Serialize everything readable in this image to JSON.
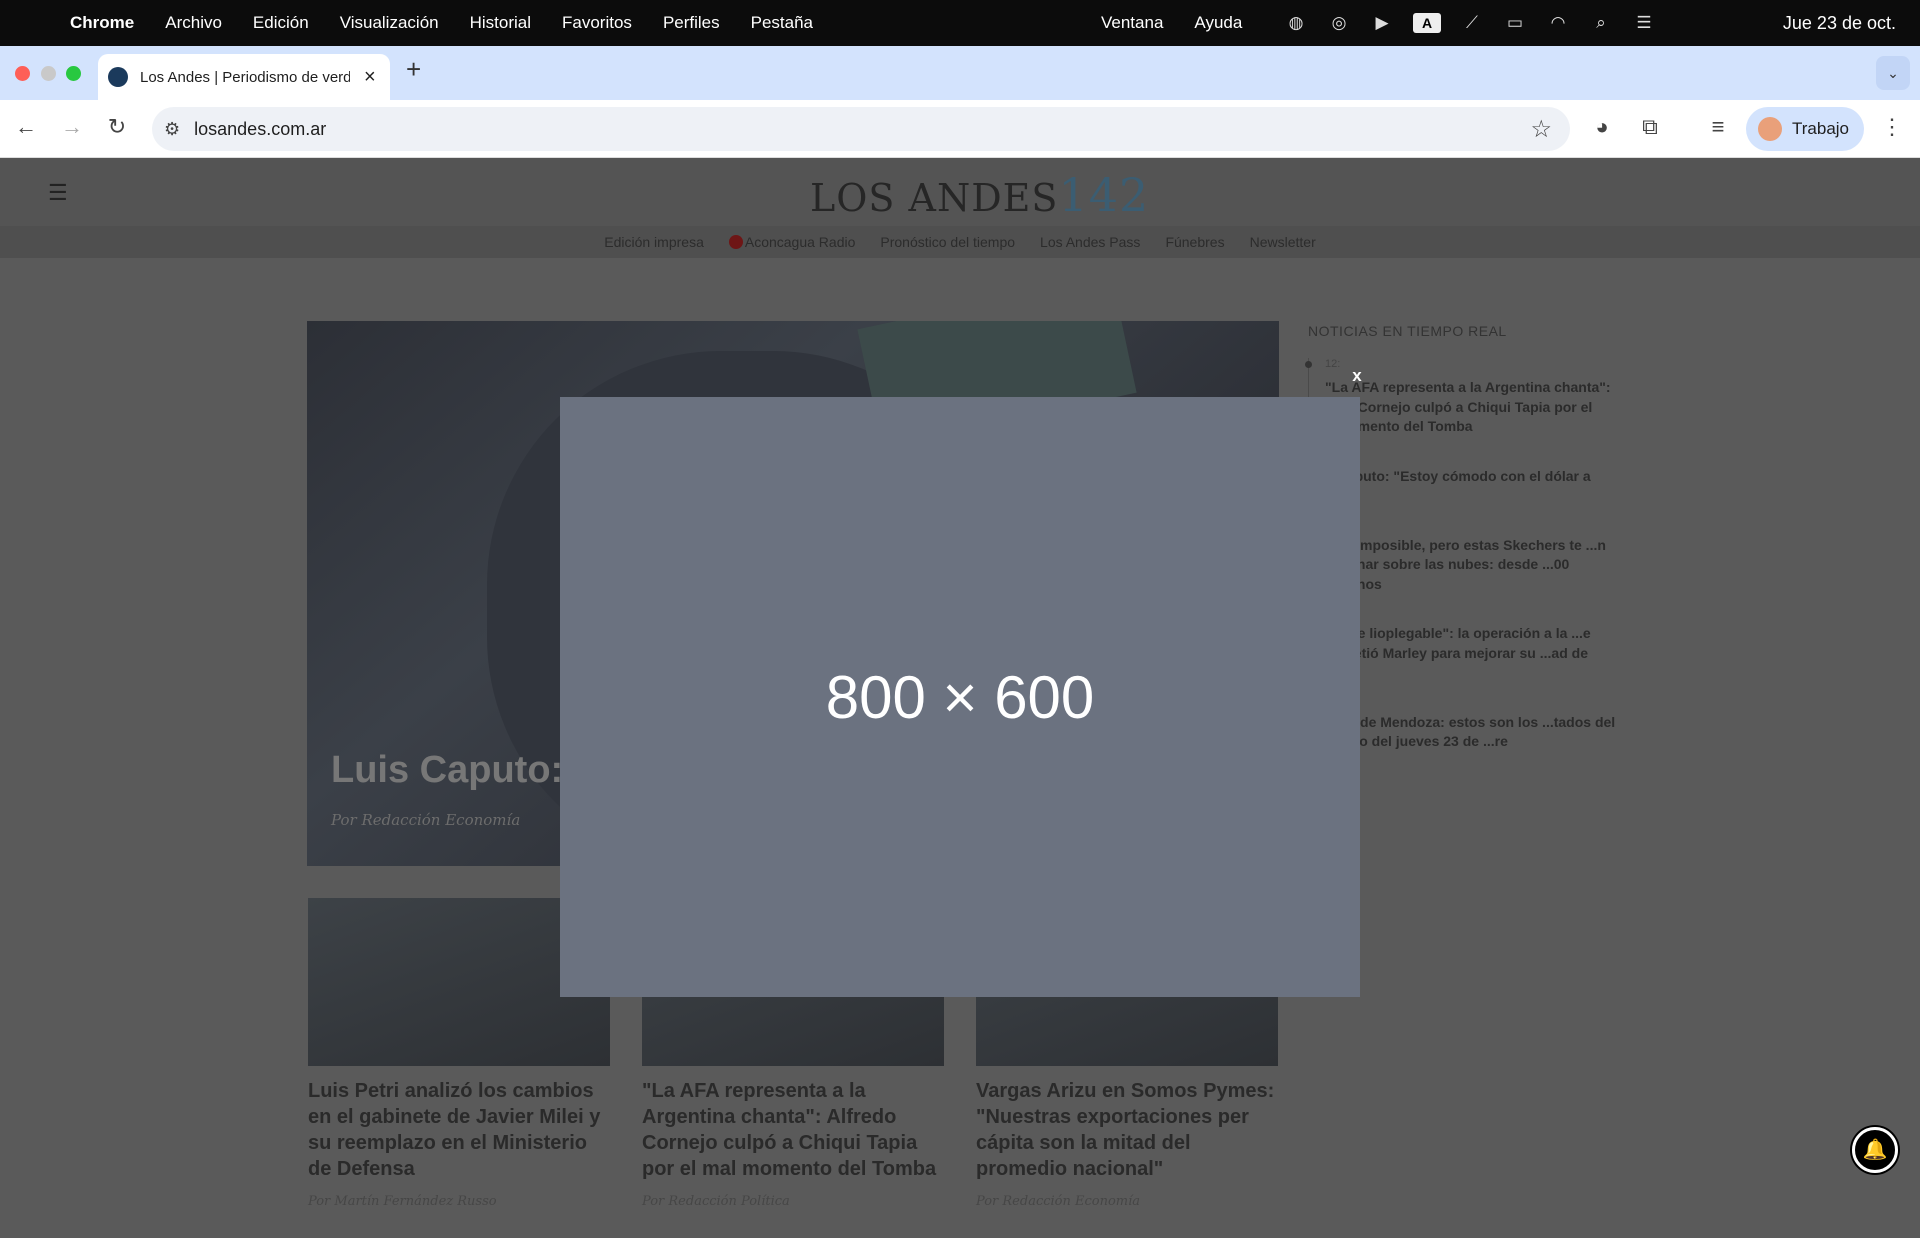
{
  "menubar": {
    "app_name": "Chrome",
    "menus": [
      "Archivo",
      "Edición",
      "Visualización",
      "Historial",
      "Favoritos",
      "Perfiles",
      "Pestaña"
    ],
    "right_menus": [
      "Ventana",
      "Ayuda"
    ],
    "keyboard_indicator": "A",
    "clock": "Jue 23 de oct."
  },
  "browser": {
    "tab_title": "Los Andes | Periodismo de verdad",
    "address": "losandes.com.ar",
    "profile_label": "Trabajo"
  },
  "site": {
    "logo_text": "LOS ANDES",
    "logo_number": "142",
    "subnav": [
      "Edición impresa",
      "Aconcagua Radio",
      "Pronóstico del tiempo",
      "Los Andes Pass",
      "Fúnebres",
      "Newsletter"
    ],
    "hero": {
      "title": "Luis Caputo: \"",
      "byline": "Por Redacción Economía"
    },
    "cards": [
      {
        "title": "Luis Petri analizó los cambios en el gabinete de Javier Milei y su reemplazo en el Ministerio de Defensa",
        "byline": "Por Martín Fernández Russo"
      },
      {
        "title": "\"La AFA representa a la Argentina chanta\": Alfredo Cornejo culpó a Chiqui Tapia por el mal momento del Tomba",
        "byline": "Por Redacción Política"
      },
      {
        "title": "Vargas Arizu en Somos Pymes: \"Nuestras exportaciones per cápita son la mitad del promedio nacional\"",
        "byline": "Por Redacción Economía"
      }
    ],
    "live": {
      "heading": "NOTICIAS EN TIEMPO REAL",
      "items": [
        {
          "time": "12:",
          "text": "\"La AFA representa a la Argentina chanta\": ...do Cornejo culpó a Chiqui Tapia por el ...momento del Tomba"
        },
        {
          "time": "",
          "text": "...Caputo: \"Estoy cómodo con el dólar a ...00\""
        },
        {
          "time": "",
          "text": "...ce imposible, pero estas Skechers te ...n caminar sobre las nubes: desde ...00 chilenos"
        },
        {
          "time": "",
          "text": "...ante lioplegable\": la operación a la ...e sometió Marley para mejorar su ...ad de vida"
        },
        {
          "time": "",
          "text": "...ela de Mendoza: estos son los ...tados del sorteo del jueves 23 de ...re"
        }
      ]
    }
  },
  "modal": {
    "label": "800 × 600",
    "close_label": "x"
  }
}
